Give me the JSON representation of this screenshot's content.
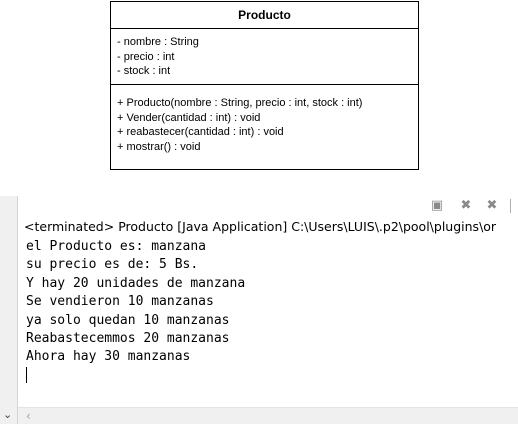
{
  "uml": {
    "class_name": "Producto",
    "attributes": [
      "- nombre : String",
      "- precio : int",
      "- stock : int"
    ],
    "methods": [
      "+ Producto(nombre : String, precio : int, stock : int)",
      "+ Vender(cantidad : int) : void",
      "+ reabastecer(cantidad : int) : void",
      "+ mostrar() : void"
    ]
  },
  "console": {
    "status": "<terminated> Producto [Java Application] C:\\Users\\LUIS\\.p2\\pool\\plugins\\or",
    "output": [
      "el Producto es: manzana",
      "su precio es de: 5 Bs.",
      "Y hay 20 unidades de manzana",
      "Se vendieron 10 manzanas",
      "ya solo quedan 10 manzanas",
      "Reabastecemmos 20 manzanas",
      "Ahora hay 30 manzanas"
    ],
    "icons": [
      "clear-console-icon",
      "remove-launch-icon",
      "remove-all-terminated-icon"
    ]
  }
}
